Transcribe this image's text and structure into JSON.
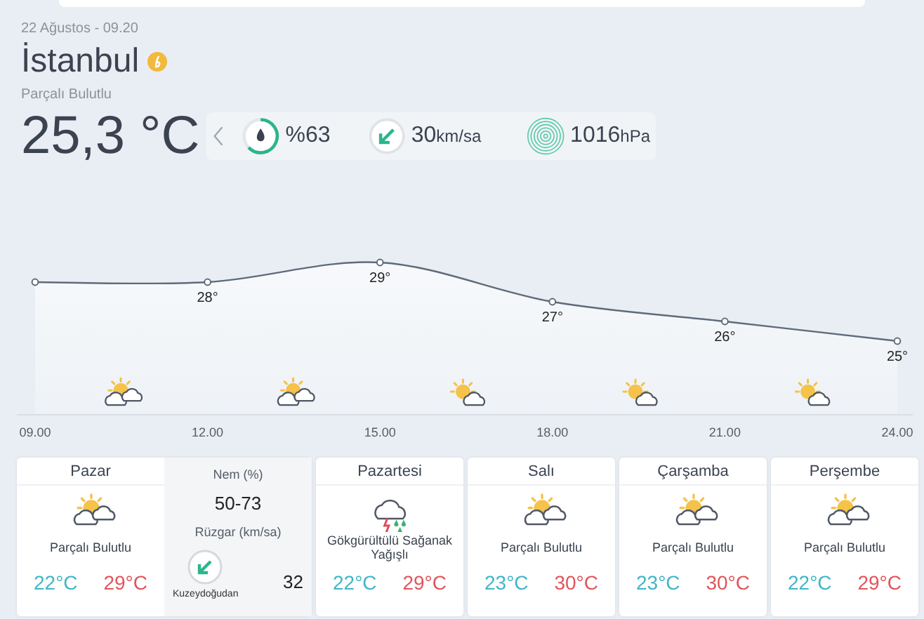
{
  "header": {
    "date": "22 Ağustos - 09.20",
    "city": "İstanbul",
    "condition": "Parçalı Bulutlu",
    "temperature": "25,3 °C"
  },
  "current": {
    "humidity": {
      "value": "%63"
    },
    "wind": {
      "value": "30",
      "unit": "km/sa"
    },
    "pressure": {
      "value": "1016",
      "unit": "hPa"
    }
  },
  "hourly": {
    "chart_data": {
      "type": "area",
      "categories": [
        "09.00",
        "12.00",
        "15.00",
        "18.00",
        "21.00",
        "24.00"
      ],
      "series": [
        {
          "color": "#5f6b7a",
          "marker": "o",
          "values": [
            28,
            28,
            29,
            27,
            26,
            25
          ],
          "value_labels": [
            null,
            "28°",
            "29°",
            "27°",
            "26°",
            "25°"
          ]
        }
      ]
    },
    "icons": [
      {
        "kind": "partly_cloudy"
      },
      {
        "kind": "partly_cloudy"
      },
      {
        "kind": "sun_cloud"
      },
      {
        "kind": "sun_cloud"
      },
      {
        "kind": "sun_cloud"
      }
    ]
  },
  "days": [
    {
      "name": "Pazar",
      "kind": "partly_cloudy",
      "condition": "Parçalı Bulutlu",
      "low": "22°C",
      "high": "29°C",
      "details": {
        "humidity_label": "Nem (%)",
        "humidity": "50-73",
        "wind_label": "Rüzgar (km/sa)",
        "wind_direction": "Kuzeydoğudan",
        "wind": "32"
      }
    },
    {
      "name": "Pazartesi",
      "kind": "thunderstorm",
      "condition": "Gökgürültülü Sağanak Yağışlı",
      "low": "22°C",
      "high": "29°C"
    },
    {
      "name": "Salı",
      "kind": "partly_cloudy",
      "condition": "Parçalı Bulutlu",
      "low": "23°C",
      "high": "30°C"
    },
    {
      "name": "Çarşamba",
      "kind": "partly_cloudy",
      "condition": "Parçalı Bulutlu",
      "low": "23°C",
      "high": "30°C"
    },
    {
      "name": "Perşembe",
      "kind": "partly_cloudy",
      "condition": "Parçalı Bulutlu",
      "low": "22°C",
      "high": "29°C"
    }
  ]
}
